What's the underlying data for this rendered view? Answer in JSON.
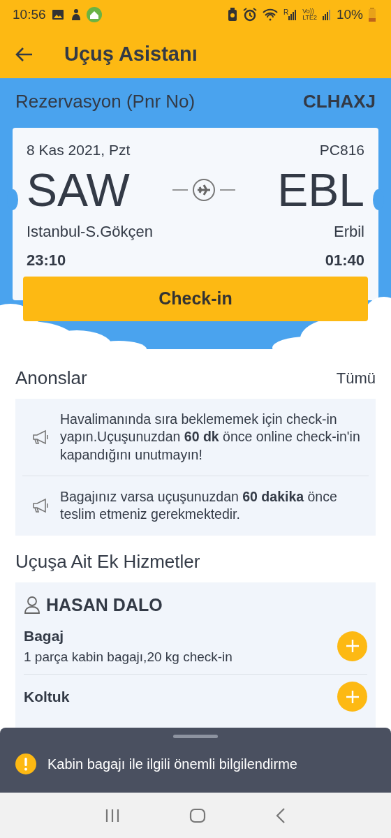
{
  "status_bar": {
    "time": "10:56",
    "roaming": "R",
    "volte": "Vo))",
    "network": "LTE2",
    "battery": "10%"
  },
  "app_bar": {
    "title": "Uçuş Asistanı"
  },
  "reservation": {
    "label": "Rezervasyon (Pnr No)",
    "pnr": "CLHAXJ"
  },
  "ticket": {
    "date": "8 Kas 2021, Pzt",
    "flight": "PC816",
    "from_code": "SAW",
    "to_code": "EBL",
    "from_city": "Istanbul-S.Gökçen",
    "to_city": "Erbil",
    "departure": "23:10",
    "arrival": "01:40"
  },
  "checkin_button": "Check-in",
  "announcements": {
    "title": "Anonslar",
    "all_link": "Tümü",
    "items": [
      {
        "text": "Havalimanında sıra beklememek için check-in yapın.Uçuşunuzdan **60 dk** önce online check-in'in kapandığını unutmayın!"
      },
      {
        "text": "Bagajınız varsa uçuşunuzdan **60 dakika** önce teslim etmeniz gerekmektedir."
      }
    ]
  },
  "services": {
    "title": "Uçuşa Ait Ek Hizmetler",
    "passenger": "HASAN DALO",
    "items": [
      {
        "name": "Bagaj",
        "detail": "1 parça kabin bagajı,20 kg check-in"
      },
      {
        "name": "Koltuk"
      }
    ]
  },
  "bottom_sheet": {
    "message": "Kabin bagajı ile ilgili önemli bilgilendirme"
  }
}
